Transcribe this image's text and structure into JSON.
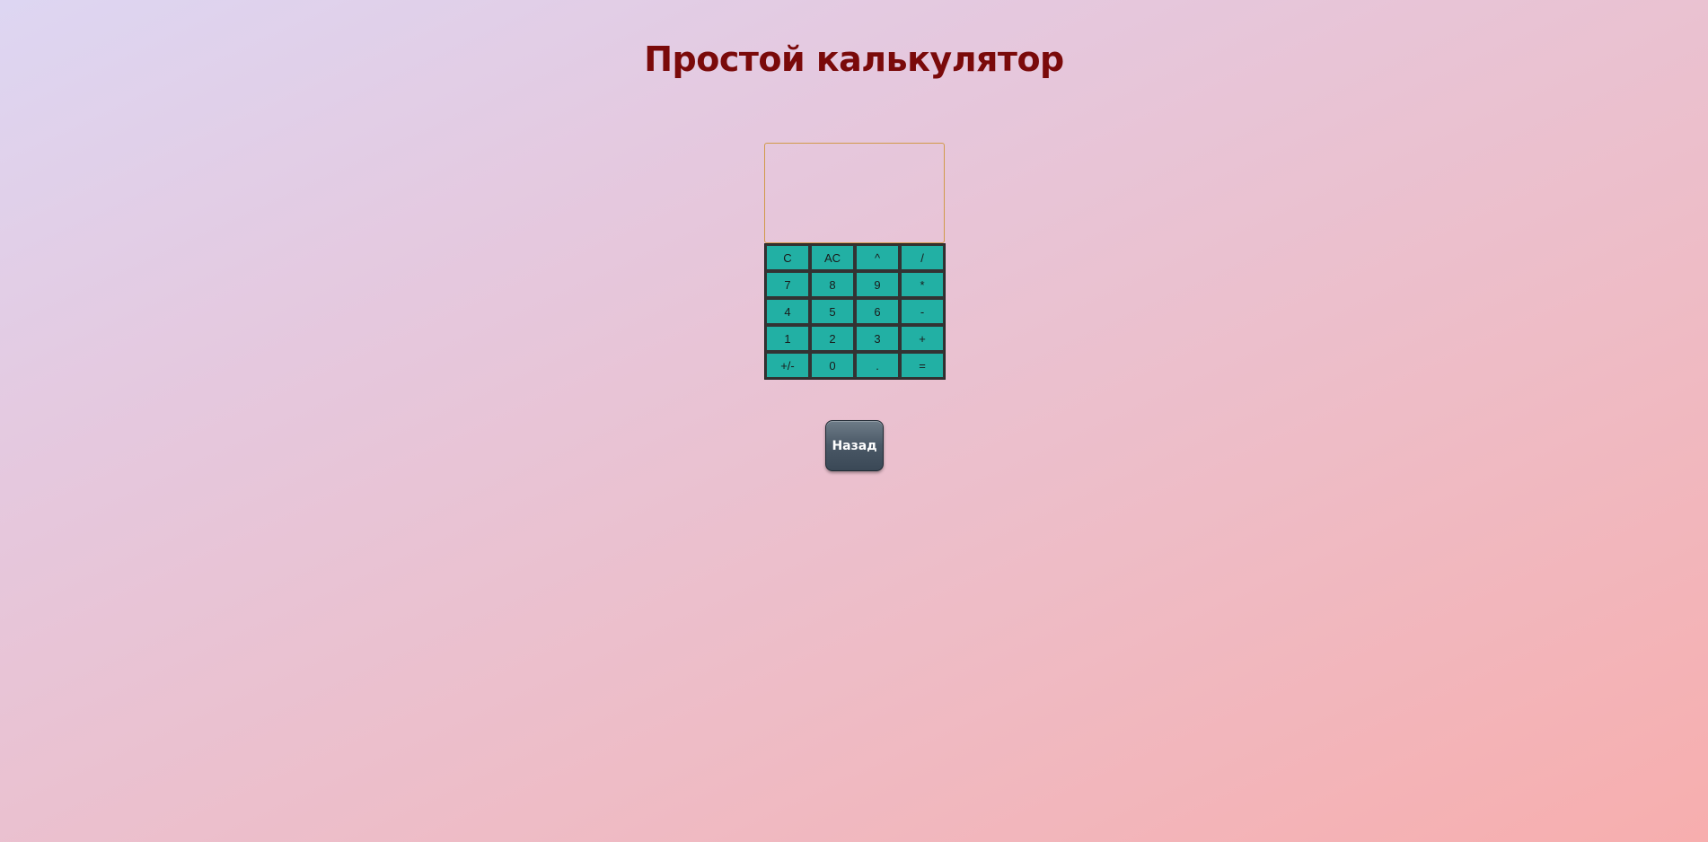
{
  "page": {
    "title": "Простой калькулятор"
  },
  "calculator": {
    "display_value": "",
    "keys": [
      [
        "C",
        "AC",
        "^",
        "/"
      ],
      [
        "7",
        "8",
        "9",
        "*"
      ],
      [
        "4",
        "5",
        "6",
        "-"
      ],
      [
        "1",
        "2",
        "3",
        "+"
      ],
      [
        "+/-",
        "0",
        ".",
        "="
      ]
    ]
  },
  "navigation": {
    "back_label": "Назад"
  },
  "colors": {
    "title": "#7a0a0a",
    "key_background": "#22b0a4",
    "display_border": "#d19a4a",
    "back_button": "#4a5866"
  }
}
